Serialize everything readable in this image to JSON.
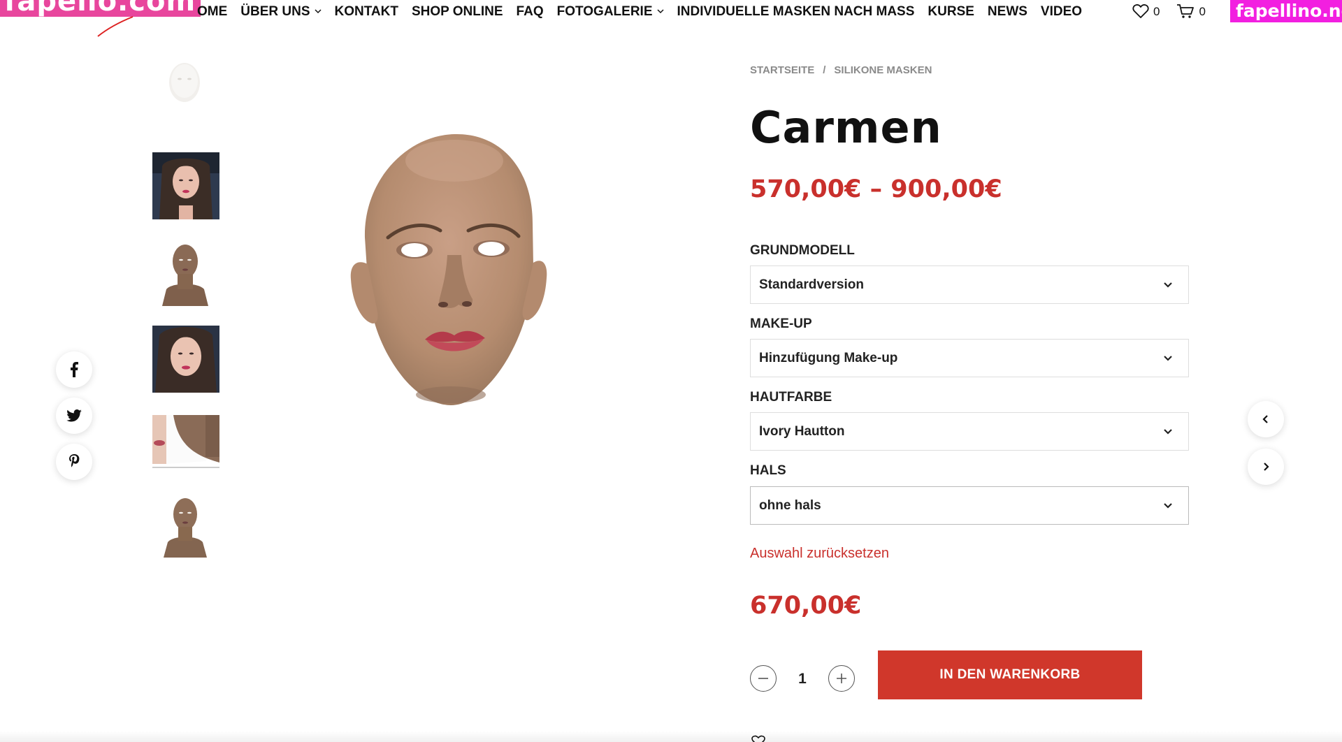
{
  "header": {
    "logo_left": "fapello.com",
    "logo_right": "fapellino.net",
    "nav": [
      {
        "label": "HOME",
        "visible_label": "OME",
        "has_dropdown": false
      },
      {
        "label": "ÜBER UNS",
        "has_dropdown": true
      },
      {
        "label": "KONTAKT",
        "has_dropdown": false
      },
      {
        "label": "SHOP ONLINE",
        "has_dropdown": false
      },
      {
        "label": "FAQ",
        "has_dropdown": false
      },
      {
        "label": "FOTOGALERIE",
        "has_dropdown": true
      },
      {
        "label": "INDIVIDUELLE MASKEN NACH MASS",
        "has_dropdown": false
      },
      {
        "label": "KURSE",
        "has_dropdown": false
      },
      {
        "label": "NEWS",
        "has_dropdown": false
      },
      {
        "label": "VIDEO",
        "has_dropdown": false
      }
    ],
    "wishlist_count": "0",
    "cart_count": "0"
  },
  "share": {
    "icons": [
      "facebook-icon",
      "twitter-icon",
      "pinterest-icon"
    ]
  },
  "product": {
    "breadcrumb": [
      "STARTSEITE",
      "SILIKONE MASKEN"
    ],
    "breadcrumb_sep": "/",
    "title": "Carmen",
    "price_range": "570,00€ – 900,00€",
    "variations": [
      {
        "label": "GRUNDMODELL",
        "value": "Standardversion"
      },
      {
        "label": "MAKE-UP",
        "value": "Hinzufügung Make-up"
      },
      {
        "label": "HAUTFARBE",
        "value": "Ivory Hautton"
      },
      {
        "label": "HALS",
        "value": "ohne hals"
      }
    ],
    "reset_label": "Auswahl zurücksetzen",
    "price": "670,00€",
    "quantity": "1",
    "add_to_cart": "IN DEN WARENKORB"
  },
  "colors": {
    "accent_red": "#c9302c",
    "button_red": "#d0372b",
    "logo_pink": "#e8469d",
    "logo_magenta": "#f21fe0"
  }
}
